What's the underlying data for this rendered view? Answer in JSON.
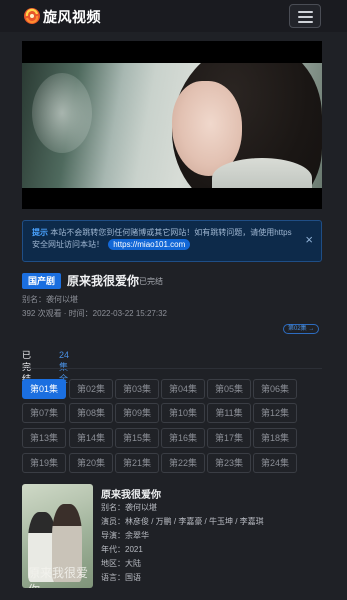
{
  "header": {
    "brand": "旋风视频",
    "logo_icon": "swirl-logo-icon",
    "menu_icon": "hamburger-menu-icon"
  },
  "notice": {
    "prefix": "提示",
    "text": "本站不会跳转您到任何赌博或其它网站！如有跳转问题，请使用https 安全网址访问本站！",
    "link": "https://miao101.com",
    "close": "×"
  },
  "show": {
    "tag": "国产剧",
    "title": "原来我很爱你",
    "status": "已完结",
    "alias": "别名：袭何以堪",
    "meta": "392 次观看 · 时间：2022-03-22 15:27:32",
    "badge": "第02集 →"
  },
  "tabs": {
    "active": "已完结",
    "second": "24集全"
  },
  "episodes": [
    "第01集",
    "第02集",
    "第03集",
    "第04集",
    "第05集",
    "第06集",
    "第07集",
    "第08集",
    "第09集",
    "第10集",
    "第11集",
    "第12集",
    "第13集",
    "第14集",
    "第15集",
    "第16集",
    "第17集",
    "第18集",
    "第19集",
    "第20集",
    "第21集",
    "第22集",
    "第23集",
    "第24集"
  ],
  "info": {
    "title": "原来我很爱你",
    "poster_text": "原来我很爱你",
    "lines": [
      "别名：袭何以堪",
      "演员：林彦俊 / 万鹏 / 李嘉豪 / 牛玉坤 / 李嘉琪",
      "导演：余翠华",
      "年代：2021",
      "地区：大陆",
      "语言：国语"
    ]
  },
  "colors": {
    "accent": "#1b6fe0",
    "background": "#1f2126"
  }
}
